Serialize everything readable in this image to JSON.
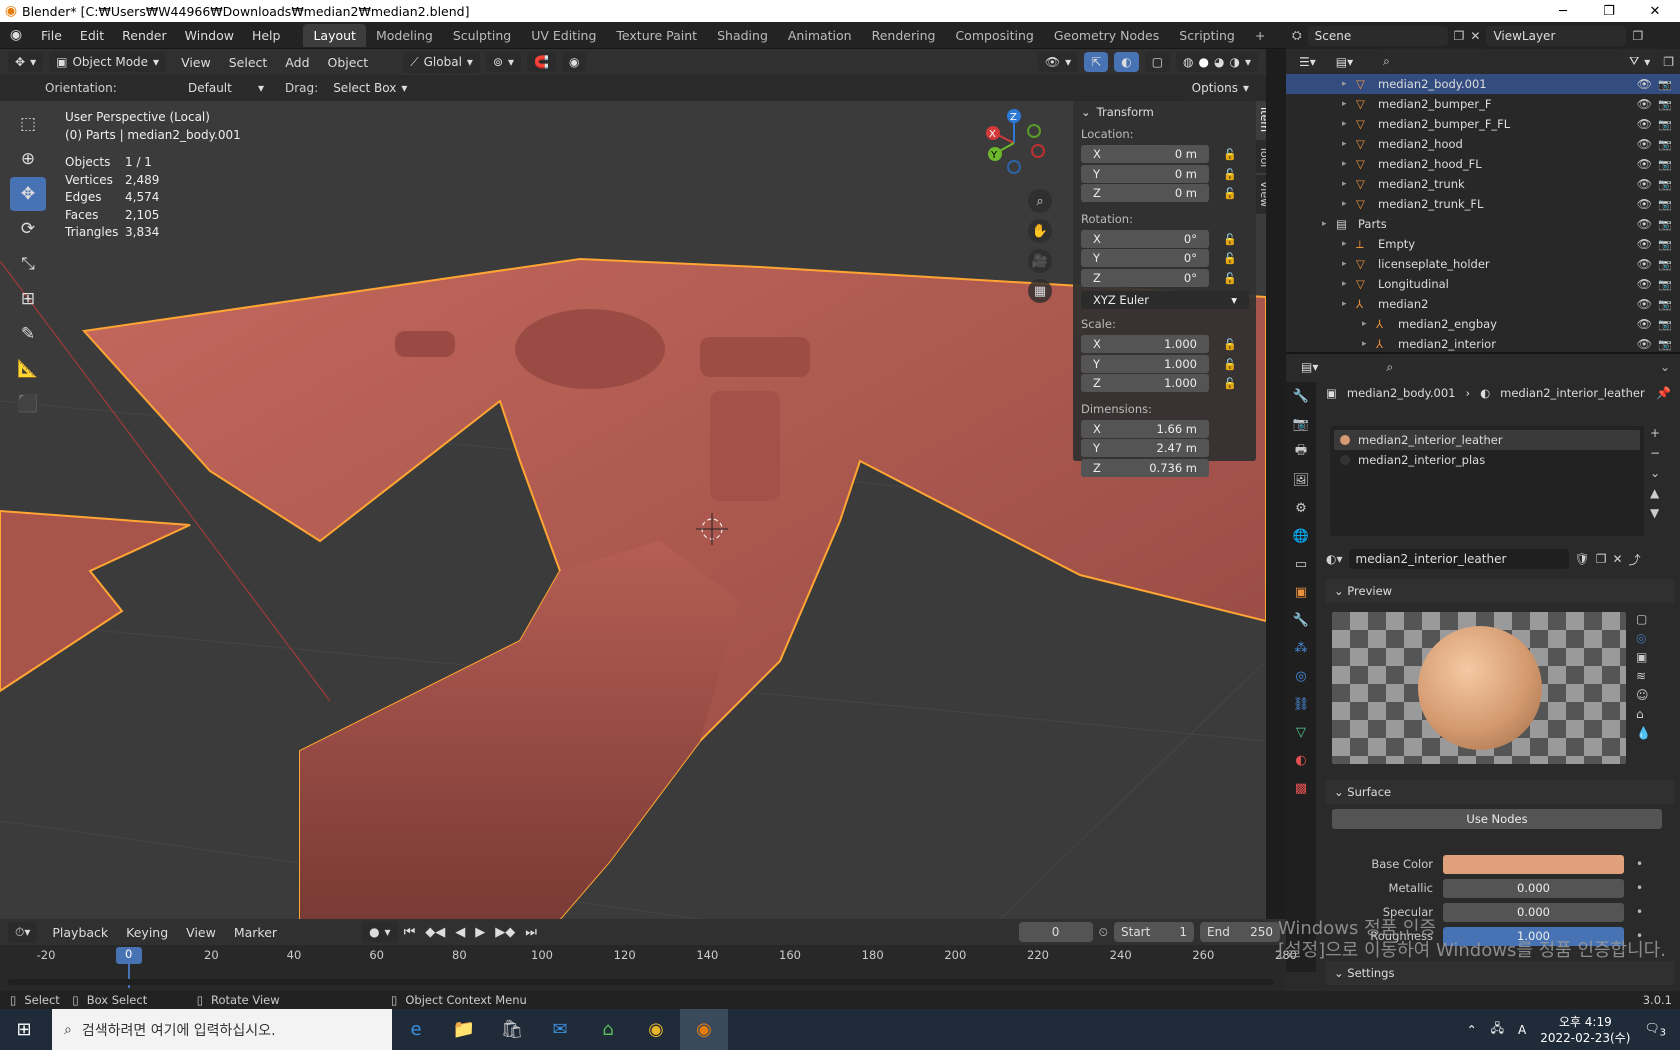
{
  "window": {
    "title": "Blender* [C:₩Users₩W44966₩Downloads₩median2₩median2.blend]"
  },
  "menu": [
    "File",
    "Edit",
    "Render",
    "Window",
    "Help"
  ],
  "workspaces": [
    "Layout",
    "Modeling",
    "Sculpting",
    "UV Editing",
    "Texture Paint",
    "Shading",
    "Animation",
    "Rendering",
    "Compositing",
    "Geometry Nodes",
    "Scripting"
  ],
  "workspace_add": "+",
  "scene": {
    "scene_name": "Scene",
    "view_layer": "ViewLayer"
  },
  "viewport_header": {
    "mode": "Object Mode",
    "menus": [
      "View",
      "Select",
      "Add",
      "Object"
    ],
    "transform_orientation": "Global"
  },
  "tool_header": {
    "orientation_label": "Orientation:",
    "orientation_value": "Default",
    "drag_label": "Drag:",
    "drag_value": "Select Box",
    "options": "Options"
  },
  "overlay": {
    "view_name": "User Perspective (Local)",
    "collection": "(0) Parts | median2_body.001",
    "stats": [
      {
        "label": "Objects",
        "value": "1 / 1"
      },
      {
        "label": "Vertices",
        "value": "2,489"
      },
      {
        "label": "Edges",
        "value": "4,574"
      },
      {
        "label": "Faces",
        "value": "2,105"
      },
      {
        "label": "Triangles",
        "value": "3,834"
      }
    ]
  },
  "npanel": {
    "tabs": [
      "Item",
      "Tool",
      "View"
    ],
    "header": "Transform",
    "location_label": "Location:",
    "location": [
      {
        "axis": "X",
        "value": "0 m"
      },
      {
        "axis": "Y",
        "value": "0 m"
      },
      {
        "axis": "Z",
        "value": "0 m"
      }
    ],
    "rotation_label": "Rotation:",
    "rotation": [
      {
        "axis": "X",
        "value": "0°"
      },
      {
        "axis": "Y",
        "value": "0°"
      },
      {
        "axis": "Z",
        "value": "0°"
      }
    ],
    "rotation_mode": "XYZ Euler",
    "scale_label": "Scale:",
    "scale": [
      {
        "axis": "X",
        "value": "1.000"
      },
      {
        "axis": "Y",
        "value": "1.000"
      },
      {
        "axis": "Z",
        "value": "1.000"
      }
    ],
    "dimensions_label": "Dimensions:",
    "dimensions": [
      {
        "axis": "X",
        "value": "1.66 m"
      },
      {
        "axis": "Y",
        "value": "2.47 m"
      },
      {
        "axis": "Z",
        "value": "0.736 m"
      }
    ]
  },
  "gizmo": {
    "x": "X",
    "y": "Y",
    "z": "Z"
  },
  "outliner": {
    "items": [
      {
        "name": "median2_body.001",
        "indent": 1,
        "selected": true,
        "icon": "mesh-icon"
      },
      {
        "name": "median2_bumper_F",
        "indent": 1,
        "selected": false,
        "icon": "mesh-icon"
      },
      {
        "name": "median2_bumper_F_FL",
        "indent": 1,
        "selected": false,
        "icon": "mesh-icon"
      },
      {
        "name": "median2_hood",
        "indent": 1,
        "selected": false,
        "icon": "mesh-icon"
      },
      {
        "name": "median2_hood_FL",
        "indent": 1,
        "selected": false,
        "icon": "mesh-icon"
      },
      {
        "name": "median2_trunk",
        "indent": 1,
        "selected": false,
        "icon": "mesh-icon"
      },
      {
        "name": "median2_trunk_FL",
        "indent": 1,
        "selected": false,
        "icon": "mesh-icon"
      },
      {
        "name": "Parts",
        "indent": 0,
        "selected": false,
        "icon": "collection-icon"
      },
      {
        "name": "Empty",
        "indent": 1,
        "selected": false,
        "icon": "empty-icon"
      },
      {
        "name": "licenseplate_holder",
        "indent": 1,
        "selected": false,
        "icon": "mesh-icon"
      },
      {
        "name": "Longitudinal",
        "indent": 1,
        "selected": false,
        "icon": "mesh-icon"
      },
      {
        "name": "median2",
        "indent": 1,
        "selected": false,
        "icon": "armature-icon"
      },
      {
        "name": "median2_engbay",
        "indent": 2,
        "selected": false,
        "icon": "armature-icon"
      },
      {
        "name": "median2_interior",
        "indent": 2,
        "selected": false,
        "icon": "armature-icon"
      }
    ]
  },
  "properties": {
    "breadcrumb_object": "median2_body.001",
    "breadcrumb_material": "median2_interior_leather",
    "slots": [
      "median2_interior_leather",
      "median2_interior_plas"
    ],
    "material_name": "median2_interior_leather",
    "preview_label": "Preview",
    "surface_label": "Surface",
    "use_nodes": "Use Nodes",
    "fields": [
      {
        "label": "Base Color",
        "value": "",
        "kind": "color",
        "color": "#e0a07a"
      },
      {
        "label": "Metallic",
        "value": "0.000",
        "kind": "num"
      },
      {
        "label": "Specular",
        "value": "0.000",
        "kind": "num"
      },
      {
        "label": "Roughness",
        "value": "1.000",
        "kind": "bar"
      }
    ],
    "settings_label": "Settings"
  },
  "timeline": {
    "menus": [
      "Playback",
      "Keying",
      "View",
      "Marker"
    ],
    "current_frame": "0",
    "start_label": "Start",
    "start": "1",
    "end_label": "End",
    "end": "250",
    "ticks": [
      "-20",
      "0",
      "20",
      "40",
      "60",
      "80",
      "100",
      "120",
      "140",
      "160",
      "180",
      "200",
      "220",
      "240",
      "260",
      "280"
    ],
    "tick_values": [
      -20,
      0,
      20,
      40,
      60,
      80,
      100,
      120,
      140,
      160,
      180,
      200,
      220,
      240,
      260,
      280
    ],
    "playhead": "0"
  },
  "statusbar": {
    "select": "Select",
    "box_select": "Box Select",
    "rotate_view": "Rotate View",
    "context_menu": "Object Context Menu",
    "version": "3.0.1"
  },
  "watermark": {
    "line1": "Windows 정품 인증",
    "line2": "[설정]으로 이동하여 Windows를 정품 인증합니다."
  },
  "taskbar": {
    "search_placeholder": "검색하려면 여기에 입력하십시오.",
    "time": "오후 4:19",
    "date": "2022-02-23(수)",
    "ime": "A",
    "notifications": "3"
  },
  "colors": {
    "accent": "#4772b3",
    "selection": "#334d80",
    "outline": "#ffa533",
    "mesh": "#b35c52"
  }
}
